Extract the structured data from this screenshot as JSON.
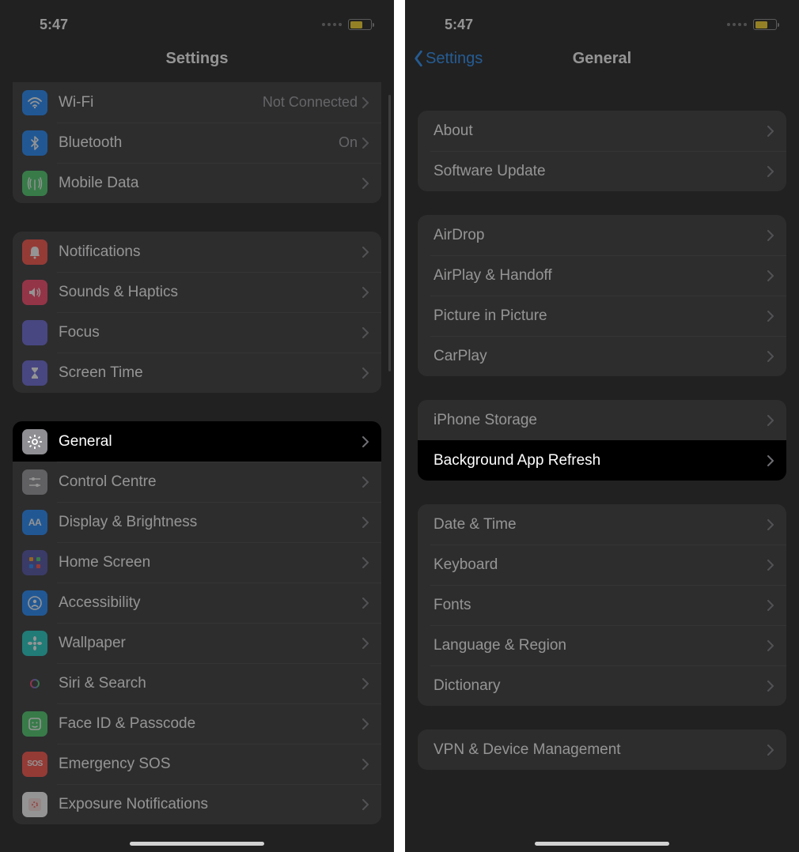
{
  "status": {
    "time": "5:47"
  },
  "left": {
    "title": "Settings",
    "group1": [
      {
        "id": "wifi",
        "label": "Wi-Fi",
        "value": "Not Connected",
        "color": "#007aff",
        "glyph": "wifi"
      },
      {
        "id": "bluetooth",
        "label": "Bluetooth",
        "value": "On",
        "color": "#007aff",
        "glyph": "bt"
      },
      {
        "id": "mobile-data",
        "label": "Mobile Data",
        "value": "",
        "color": "#34c759",
        "glyph": "antenna"
      }
    ],
    "group2": [
      {
        "id": "notifications",
        "label": "Notifications",
        "color": "#ff3b30",
        "glyph": "bell"
      },
      {
        "id": "sounds",
        "label": "Sounds & Haptics",
        "color": "#ff2d55",
        "glyph": "speaker"
      },
      {
        "id": "focus",
        "label": "Focus",
        "color": "#5856d6",
        "glyph": "moon"
      },
      {
        "id": "screen-time",
        "label": "Screen Time",
        "color": "#5856d6",
        "glyph": "hourglass"
      }
    ],
    "group3": [
      {
        "id": "general",
        "label": "General",
        "color": "#8e8e93",
        "glyph": "gear",
        "highlight": true
      },
      {
        "id": "control-centre",
        "label": "Control Centre",
        "color": "#8e8e93",
        "glyph": "sliders"
      },
      {
        "id": "display",
        "label": "Display & Brightness",
        "color": "#007aff",
        "glyph": "AA"
      },
      {
        "id": "home-screen",
        "label": "Home Screen",
        "color": "#3a3a9e",
        "glyph": "grid"
      },
      {
        "id": "accessibility",
        "label": "Accessibility",
        "color": "#007aff",
        "glyph": "person"
      },
      {
        "id": "wallpaper",
        "label": "Wallpaper",
        "color": "#00c7be",
        "glyph": "flower"
      },
      {
        "id": "siri",
        "label": "Siri & Search",
        "color": "#1c1c1e",
        "glyph": "siri"
      },
      {
        "id": "faceid",
        "label": "Face ID & Passcode",
        "color": "#34c759",
        "glyph": "face"
      },
      {
        "id": "sos",
        "label": "Emergency SOS",
        "color": "#ff3b30",
        "glyph": "SOS"
      },
      {
        "id": "exposure",
        "label": "Exposure Notifications",
        "color": "#ffffff",
        "glyph": "exposure"
      }
    ]
  },
  "right": {
    "back": "Settings",
    "title": "General",
    "group1": [
      {
        "id": "about",
        "label": "About"
      },
      {
        "id": "software-update",
        "label": "Software Update"
      }
    ],
    "group2": [
      {
        "id": "airdrop",
        "label": "AirDrop"
      },
      {
        "id": "airplay",
        "label": "AirPlay & Handoff"
      },
      {
        "id": "pip",
        "label": "Picture in Picture"
      },
      {
        "id": "carplay",
        "label": "CarPlay"
      }
    ],
    "group3": [
      {
        "id": "iphone-storage",
        "label": "iPhone Storage"
      },
      {
        "id": "bg-app-refresh",
        "label": "Background App Refresh",
        "highlight": true
      }
    ],
    "group4": [
      {
        "id": "date-time",
        "label": "Date & Time"
      },
      {
        "id": "keyboard",
        "label": "Keyboard"
      },
      {
        "id": "fonts",
        "label": "Fonts"
      },
      {
        "id": "language-region",
        "label": "Language & Region"
      },
      {
        "id": "dictionary",
        "label": "Dictionary"
      }
    ],
    "group5": [
      {
        "id": "vpn",
        "label": "VPN & Device Management"
      }
    ]
  },
  "icon_text": {
    "AA": "AA",
    "SOS": "SOS"
  }
}
